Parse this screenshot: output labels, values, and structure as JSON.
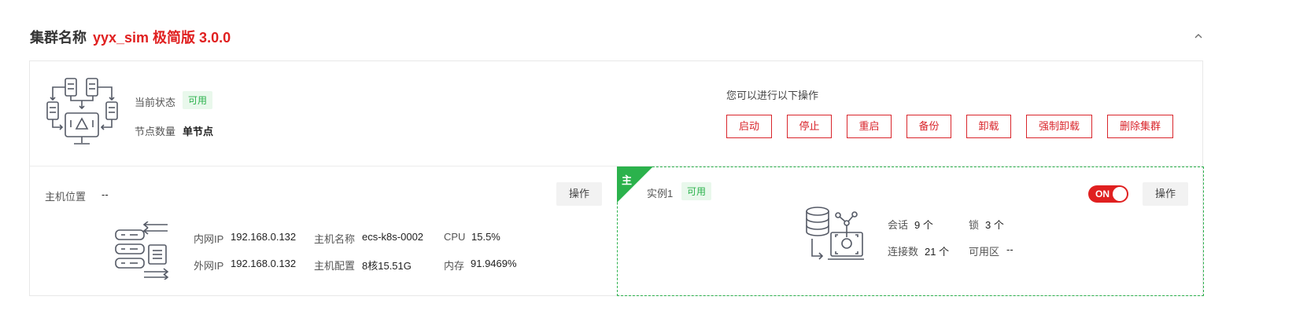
{
  "header": {
    "cluster_label": "集群名称",
    "cluster_name": "yyx_sim 极简版 3.0.0"
  },
  "status": {
    "state_label": "当前状态",
    "state_value": "可用",
    "nodes_label": "节点数量",
    "nodes_value": "单节点"
  },
  "operations": {
    "title": "您可以进行以下操作",
    "buttons": [
      "启动",
      "停止",
      "重启",
      "备份",
      "卸载",
      "强制卸载",
      "删除集群"
    ]
  },
  "host": {
    "location_label": "主机位置",
    "location_value": "--",
    "op_label": "操作",
    "inner_ip_label": "内网IP",
    "inner_ip": "192.168.0.132",
    "outer_ip_label": "外网IP",
    "outer_ip": "192.168.0.132",
    "hostname_label": "主机名称",
    "hostname": "ecs-k8s-0002",
    "config_label": "主机配置",
    "config": "8核15.51G",
    "cpu_label": "CPU",
    "cpu": "15.5%",
    "mem_label": "内存",
    "mem": "91.9469%"
  },
  "instance": {
    "corner_label": "主",
    "name": "实例1",
    "state": "可用",
    "toggle_label": "ON",
    "toggle_on": true,
    "op_label": "操作",
    "sessions_label": "会话",
    "sessions": "9 个",
    "locks_label": "锁",
    "locks": "3 个",
    "connections_label": "连接数",
    "connections": "21 个",
    "zone_label": "可用区",
    "zone": "--"
  },
  "colors": {
    "accent_red": "#e02020",
    "success_green": "#2bb24c",
    "icon_gray": "#555a66"
  }
}
